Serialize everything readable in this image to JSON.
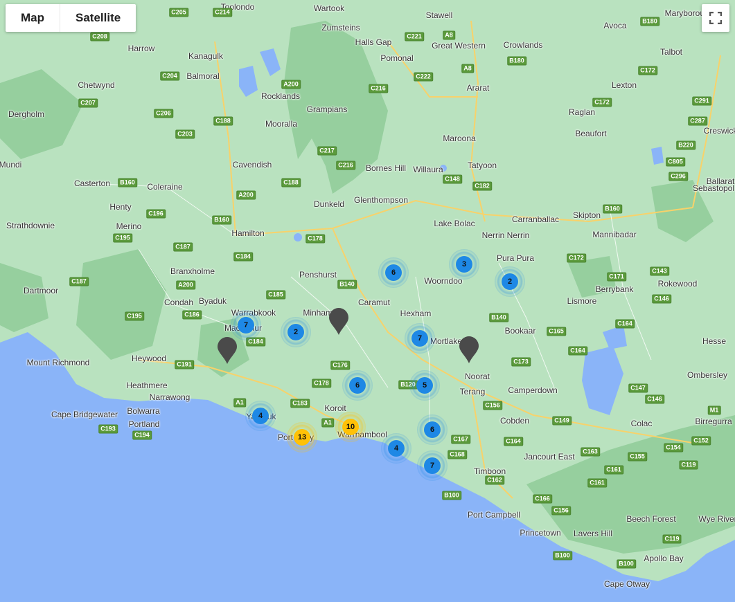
{
  "controls": {
    "map_label": "Map",
    "satellite_label": "Satellite"
  },
  "colors": {
    "land": "#b9e2bf",
    "ocean": "#8ab4f8",
    "forest": "#96cf9e",
    "cluster_blue": "#1e88e5",
    "cluster_yellow": "#ffc107",
    "pin": "#4a4a4a"
  },
  "places": [
    "Toolondo",
    "Wartook",
    "Stawell",
    "Maryborough",
    "Zumsteins",
    "Halls Gap",
    "Great Western",
    "Avoca",
    "Harrow",
    "Kanagulk",
    "Pomonal",
    "Crowlands",
    "Talbot",
    "Balmoral",
    "Chetwynd",
    "Rocklands",
    "Ararat",
    "Lexton",
    "Dergholm",
    "Grampians",
    "Raglan",
    "Mooralla",
    "Beaufort",
    "Creswick",
    "Maroona",
    "Mundi",
    "Cavendish",
    "Bornes Hill",
    "Willaura",
    "Tatyoon",
    "Casterton",
    "Coleraine",
    "Ballarat",
    "Sebastopol",
    "Henty",
    "Dunkeld",
    "Glenthompson",
    "Skipton",
    "Strathdownie",
    "Merino",
    "Lake Bolac",
    "Carranballac",
    "Mannibadar",
    "Hamilton",
    "Nerrin Nerrin",
    "Pura Pura",
    "Branxholme",
    "Penshurst",
    "Woorndoo",
    "Dartmoor",
    "Byaduk",
    "Caramut",
    "Lismore",
    "Berrybank",
    "Rokewood",
    "Condah",
    "Warrabkook",
    "Minhamite",
    "Hexham",
    "Macarthur",
    "Mortlake",
    "Bookaar",
    "Hesse",
    "Mount Richmond",
    "Heywood",
    "Noorat",
    "Ombersley",
    "Heathmere",
    "Terang",
    "Camperdown",
    "Narrawong",
    "Koroit",
    "Cape Bridgewater",
    "Bolwarra",
    "Portland",
    "Yambuk",
    "Port Fairy",
    "Warrnambool",
    "Cobden",
    "Colac",
    "Birregurra",
    "Jancourt East",
    "Timboon",
    "Port Campbell",
    "Beech Forest",
    "Wye River",
    "Princetown",
    "Lavers Hill",
    "Apollo Bay",
    "Cape Otway"
  ],
  "roads": [
    "C205",
    "C214",
    "C221",
    "C208",
    "A8",
    "B180",
    "A8",
    "C204",
    "C222",
    "B180",
    "C172",
    "A200",
    "C216",
    "C207",
    "C206",
    "C188",
    "C172",
    "C291",
    "C203",
    "C287",
    "C217",
    "B220",
    "C216",
    "C805",
    "C296",
    "B160",
    "C148",
    "C182",
    "C188",
    "A200",
    "C196",
    "B160",
    "B160",
    "C195",
    "C178",
    "C187",
    "C184",
    "C172",
    "C143",
    "B140",
    "C171",
    "C187",
    "C185",
    "C146",
    "A200",
    "C195",
    "C186",
    "B140",
    "C164",
    "C184",
    "C165",
    "C191",
    "C176",
    "C173",
    "C164",
    "C178",
    "B120",
    "C147",
    "C146",
    "A1",
    "C183",
    "C156",
    "M1",
    "C193",
    "C194",
    "A1",
    "C149",
    "C167",
    "C164",
    "C152",
    "C154",
    "C168",
    "C163",
    "C155",
    "C119",
    "C161",
    "C162",
    "C161",
    "B100",
    "C166",
    "C156",
    "C119",
    "B100",
    "B100"
  ],
  "clusters": [
    {
      "count": "7",
      "color": "blue"
    },
    {
      "count": "2",
      "color": "blue"
    },
    {
      "count": "6",
      "color": "blue"
    },
    {
      "count": "3",
      "color": "blue"
    },
    {
      "count": "2",
      "color": "blue"
    },
    {
      "count": "7",
      "color": "blue"
    },
    {
      "count": "6",
      "color": "blue"
    },
    {
      "count": "5",
      "color": "blue"
    },
    {
      "count": "4",
      "color": "blue"
    },
    {
      "count": "13",
      "color": "yellow"
    },
    {
      "count": "10",
      "color": "yellow"
    },
    {
      "count": "6",
      "color": "blue"
    },
    {
      "count": "4",
      "color": "blue"
    },
    {
      "count": "7",
      "color": "blue"
    }
  ],
  "markers": [
    "location-pin",
    "location-pin",
    "location-pin"
  ]
}
